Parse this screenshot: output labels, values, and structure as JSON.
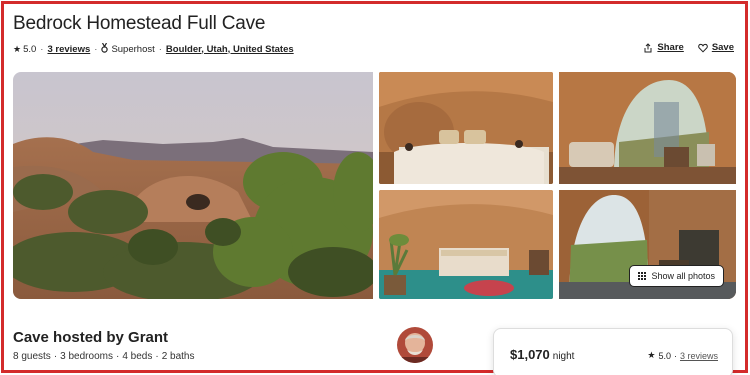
{
  "listing": {
    "title": "Bedrock Homestead Full Cave",
    "rating": "5.0",
    "reviews_link": "3 reviews",
    "superhost_label": "Superhost",
    "location": "Boulder, Utah, United States"
  },
  "actions": {
    "share_label": "Share",
    "save_label": "Save"
  },
  "gallery": {
    "show_all_label": "Show all photos"
  },
  "host": {
    "title": "Cave hosted by Grant",
    "guests": "8 guests",
    "bedrooms": "3 bedrooms",
    "beds": "4 beds",
    "baths": "2 baths"
  },
  "booking": {
    "price": "$1,070",
    "price_unit": "night",
    "rating": "5.0",
    "reviews_link": "3 reviews"
  },
  "icons": {
    "star": "star-icon",
    "superhost": "medal-icon",
    "share": "share-icon",
    "save": "heart-icon",
    "grid": "grid-icon"
  },
  "colors": {
    "frame_border": "#d32b2b",
    "text": "#222222"
  }
}
